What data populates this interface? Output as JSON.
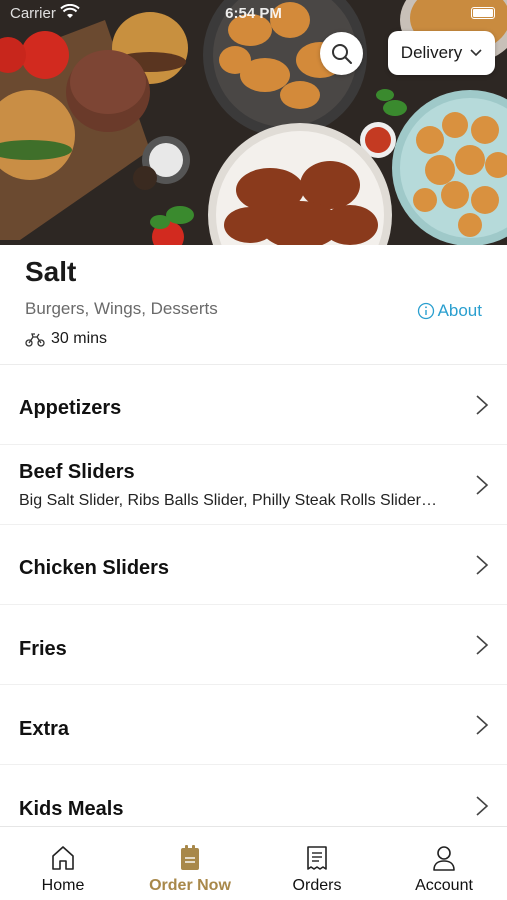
{
  "status": {
    "carrier": "Carrier",
    "time": "6:54 PM"
  },
  "hero": {
    "image_icon": "food-collage-image"
  },
  "header": {
    "delivery_label": "Delivery",
    "search_icon": "search-icon"
  },
  "restaurant": {
    "name": "Salt",
    "cuisines": "Burgers, Wings, Desserts",
    "about_label": "About",
    "eta": "30 mins"
  },
  "categories": [
    {
      "title": "Appetizers",
      "subtitle": ""
    },
    {
      "title": "Beef Sliders",
      "subtitle": "Big Salt Slider, Ribs Balls Slider, Philly Steak Rolls Slider…"
    },
    {
      "title": "Chicken Sliders",
      "subtitle": ""
    },
    {
      "title": "Fries",
      "subtitle": ""
    },
    {
      "title": "Extra",
      "subtitle": ""
    },
    {
      "title": "Kids Meals",
      "subtitle": ""
    }
  ],
  "tabs": [
    {
      "label": "Home",
      "icon": "home-icon"
    },
    {
      "label": "Order Now",
      "icon": "order-bag-icon"
    },
    {
      "label": "Orders",
      "icon": "receipt-icon"
    },
    {
      "label": "Account",
      "icon": "account-icon"
    }
  ],
  "colors": {
    "accent": "#a8884a",
    "link": "#2a9fcf"
  }
}
